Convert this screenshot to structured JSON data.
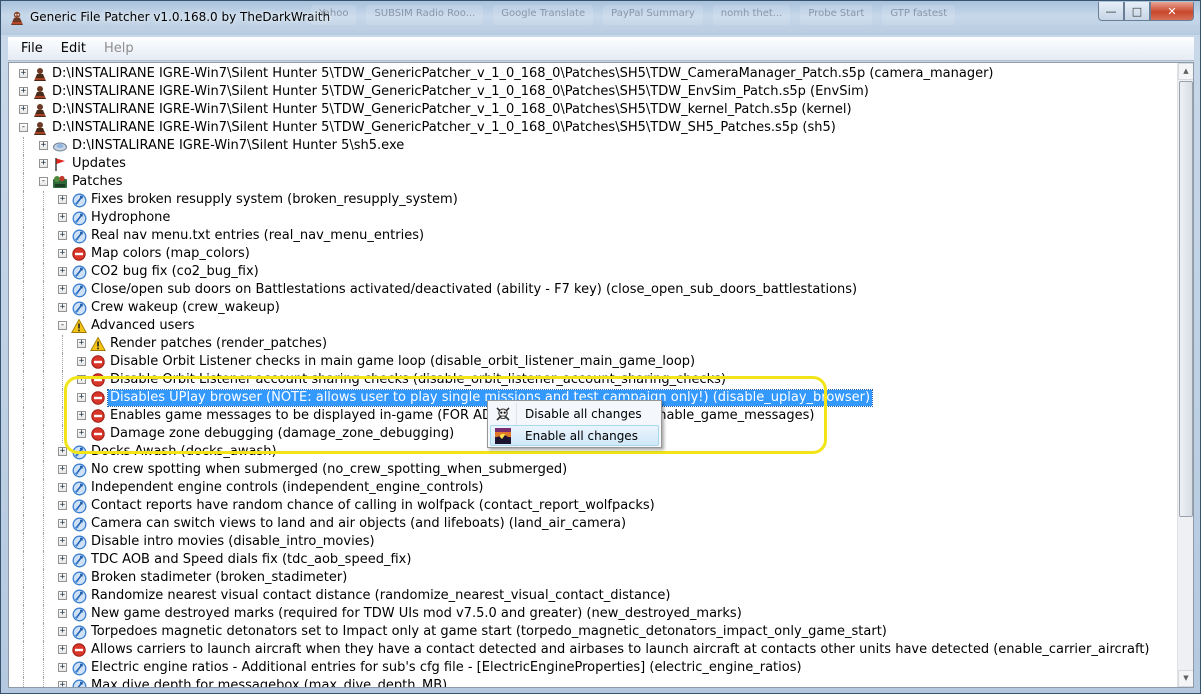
{
  "window": {
    "title": "Generic File Patcher v1.0.168.0 by TheDarkWraith",
    "background_tabs": [
      "Yahoo",
      "SUBSIM Radio Roo...",
      "Google Translate",
      "PayPal Summary",
      "nomh thet...",
      "Probe Start",
      "GTP fastest"
    ],
    "controls": {
      "minimize": "—",
      "maximize": "□",
      "close": "✕"
    }
  },
  "menu": {
    "file": "File",
    "edit": "Edit",
    "help": "Help"
  },
  "tree": [
    {
      "level": 0,
      "expander": "+",
      "icon": "patch-file-icon",
      "text": "D:\\INSTALIRANE IGRE-Win7\\Silent Hunter 5\\TDW_GenericPatcher_v_1_0_168_0\\Patches\\SH5\\TDW_CameraManager_Patch.s5p  (camera_manager)"
    },
    {
      "level": 0,
      "expander": "+",
      "icon": "patch-file-icon",
      "text": "D:\\INSTALIRANE IGRE-Win7\\Silent Hunter 5\\TDW_GenericPatcher_v_1_0_168_0\\Patches\\SH5\\TDW_EnvSim_Patch.s5p  (EnvSim)"
    },
    {
      "level": 0,
      "expander": "+",
      "icon": "patch-file-icon",
      "text": "D:\\INSTALIRANE IGRE-Win7\\Silent Hunter 5\\TDW_GenericPatcher_v_1_0_168_0\\Patches\\SH5\\TDW_kernel_Patch.s5p  (kernel)"
    },
    {
      "level": 0,
      "expander": "-",
      "icon": "patch-file-icon",
      "text": "D:\\INSTALIRANE IGRE-Win7\\Silent Hunter 5\\TDW_GenericPatcher_v_1_0_168_0\\Patches\\SH5\\TDW_SH5_Patches.s5p  (sh5)"
    },
    {
      "level": 1,
      "expander": "+",
      "icon": "exe-file-icon",
      "text": "D:\\INSTALIRANE IGRE-Win7\\Silent Hunter 5\\sh5.exe"
    },
    {
      "level": 1,
      "expander": "+",
      "icon": "updates-flag-icon",
      "text": "Updates"
    },
    {
      "level": 1,
      "expander": "-",
      "icon": "patches-folder-icon",
      "text": "Patches"
    },
    {
      "level": 2,
      "expander": "+",
      "icon": "patch-enabled-icon",
      "text": "Fixes broken resupply system  (broken_resupply_system)"
    },
    {
      "level": 2,
      "expander": "+",
      "icon": "patch-enabled-icon",
      "text": "Hydrophone"
    },
    {
      "level": 2,
      "expander": "+",
      "icon": "patch-enabled-icon",
      "text": "Real nav menu.txt entries  (real_nav_menu_entries)"
    },
    {
      "level": 2,
      "expander": "+",
      "icon": "patch-disabled-icon",
      "text": "Map colors  (map_colors)"
    },
    {
      "level": 2,
      "expander": "+",
      "icon": "patch-enabled-icon",
      "text": "CO2 bug fix  (co2_bug_fix)"
    },
    {
      "level": 2,
      "expander": "+",
      "icon": "patch-enabled-icon",
      "text": "Close/open sub doors on Battlestations activated/deactivated (ability - F7 key)  (close_open_sub_doors_battlestations)"
    },
    {
      "level": 2,
      "expander": "+",
      "icon": "patch-enabled-icon",
      "text": "Crew wakeup  (crew_wakeup)"
    },
    {
      "level": 2,
      "expander": "-",
      "icon": "warning-icon",
      "text": "Advanced users"
    },
    {
      "level": 3,
      "expander": "+",
      "icon": "warning-icon",
      "text": "Render patches  (render_patches)"
    },
    {
      "level": 3,
      "expander": "+",
      "icon": "patch-disabled-icon",
      "text": "Disable Orbit Listener checks in main game loop  (disable_orbit_listener_main_game_loop)"
    },
    {
      "level": 3,
      "expander": "+",
      "icon": "patch-disabled-icon",
      "text": "Disable Orbit Listener account sharing checks  (disable_orbit_listener_account_sharing_checks)"
    },
    {
      "level": 3,
      "expander": "+",
      "icon": "patch-disabled-icon",
      "text": "Disables UPlay browser (NOTE: allows user to play single missions and test campaign only!)  (disable_uplay_browser)",
      "selected": true
    },
    {
      "level": 3,
      "expander": "+",
      "icon": "patch-disabled-icon",
      "text": "Enables game messages to be displayed in-game (FOR ADVANCED USERS ONLY!)  (enable_game_messages)"
    },
    {
      "level": 3,
      "expander": "+",
      "icon": "patch-disabled-icon",
      "text": "Damage zone debugging  (damage_zone_debugging)"
    },
    {
      "level": 2,
      "expander": "+",
      "icon": "patch-enabled-icon",
      "text": "Docks Awash  (docks_awash)"
    },
    {
      "level": 2,
      "expander": "+",
      "icon": "patch-enabled-icon",
      "text": "No crew spotting when submerged  (no_crew_spotting_when_submerged)"
    },
    {
      "level": 2,
      "expander": "+",
      "icon": "patch-enabled-icon",
      "text": "Independent engine controls  (independent_engine_controls)"
    },
    {
      "level": 2,
      "expander": "+",
      "icon": "patch-enabled-icon",
      "text": "Contact reports have random chance of calling in wolfpack  (contact_report_wolfpacks)"
    },
    {
      "level": 2,
      "expander": "+",
      "icon": "patch-enabled-icon",
      "text": "Camera can switch views to land and air objects (and lifeboats)  (land_air_camera)"
    },
    {
      "level": 2,
      "expander": "+",
      "icon": "patch-enabled-icon",
      "text": "Disable intro movies  (disable_intro_movies)"
    },
    {
      "level": 2,
      "expander": "+",
      "icon": "patch-enabled-icon",
      "text": "TDC AOB and Speed dials fix  (tdc_aob_speed_fix)"
    },
    {
      "level": 2,
      "expander": "+",
      "icon": "patch-enabled-icon",
      "text": "Broken stadimeter  (broken_stadimeter)"
    },
    {
      "level": 2,
      "expander": "+",
      "icon": "patch-enabled-icon",
      "text": "Randomize nearest visual contact distance  (randomize_nearest_visual_contact_distance)"
    },
    {
      "level": 2,
      "expander": "+",
      "icon": "patch-enabled-icon",
      "text": "New game destroyed marks (required for TDW UIs mod v7.5.0 and greater)  (new_destroyed_marks)"
    },
    {
      "level": 2,
      "expander": "+",
      "icon": "patch-enabled-icon",
      "text": "Torpedoes magnetic detonators set to Impact only at game start  (torpedo_magnetic_detonators_impact_only_game_start)"
    },
    {
      "level": 2,
      "expander": "+",
      "icon": "patch-disabled-icon",
      "text": "Allows carriers to launch aircraft when they have a contact detected and airbases to launch aircraft at contacts other units have detected  (enable_carrier_aircraft)"
    },
    {
      "level": 2,
      "expander": "+",
      "icon": "patch-enabled-icon",
      "text": "Electric engine ratios - Additional entries for sub's cfg file - [ElectricEngineProperties]  (electric_engine_ratios)"
    },
    {
      "level": 2,
      "expander": "+",
      "icon": "patch-enabled-icon",
      "text": "Max dive depth for messagebox  (max_dive_depth_MB)"
    }
  ],
  "context_menu": {
    "items": [
      {
        "label": "Disable all changes",
        "icon": "skull-icon"
      },
      {
        "label": "Enable all changes",
        "icon": "sunrise-icon",
        "hover": true
      }
    ]
  },
  "colors": {
    "selection": "#3399ff",
    "highlight_ring": "#f1e518",
    "enabled_icon": "#3a7fd0",
    "disabled_icon": "#d9362a",
    "warning_icon": "#f3c317"
  }
}
